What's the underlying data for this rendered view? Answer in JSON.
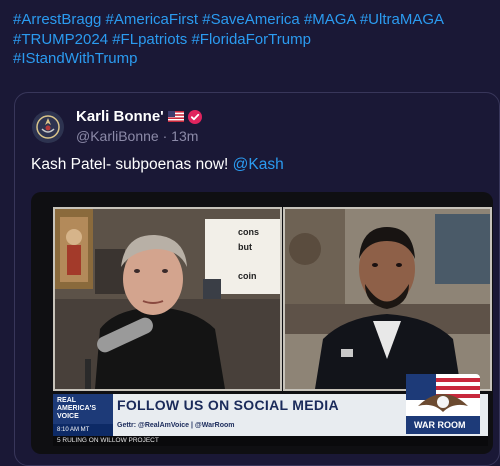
{
  "hashtags": [
    "#ArrestBragg",
    "#AmericaFirst",
    "#SaveAmerica",
    "#MAGA",
    "#UltraMAGA",
    "#TRUMP2024",
    "#FLpatriots",
    "#FloridaForTrump",
    "#IStandWithTrump"
  ],
  "quoted": {
    "author_name": "Karli Bonne'",
    "handle": "@KarliBonne",
    "separator": "·",
    "time": "13m",
    "text_before": "Kash Patel- subpoenas now! ",
    "mention": "@Kash"
  },
  "video": {
    "network_logo": "REAL AMERICA'S VOICE",
    "clock": "8:10 AM MT",
    "headline": "FOLLOW US ON SOCIAL MEDIA",
    "subline": "Gettr: @RealAmVoice | @WarRoom",
    "warroom_badge": "WAR ROOM",
    "ticker": "5 RULING ON WILLOW PROJECT",
    "bg_text_1": "cons",
    "bg_text_2": "but",
    "bg_text_3": "coin"
  },
  "colors": {
    "background": "#1a1836",
    "link": "#2b9bf0",
    "muted": "#8c8aa8",
    "verified": "#e0245e"
  }
}
